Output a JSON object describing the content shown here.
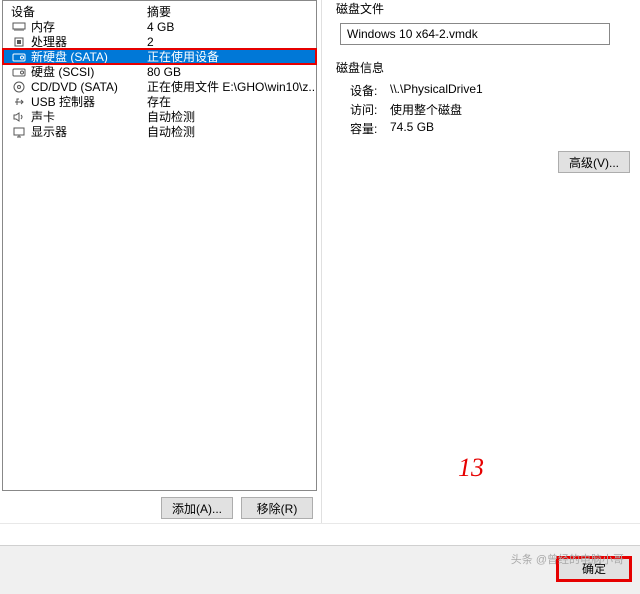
{
  "headers": {
    "device": "设备",
    "summary": "摘要"
  },
  "devices": [
    {
      "icon": "memory",
      "name": "内存",
      "summary": "4 GB",
      "selected": false
    },
    {
      "icon": "cpu",
      "name": "处理器",
      "summary": "2",
      "selected": false
    },
    {
      "icon": "disk",
      "name": "新硬盘 (SATA)",
      "summary": "正在使用设备",
      "selected": true
    },
    {
      "icon": "disk",
      "name": "硬盘 (SCSI)",
      "summary": "80 GB",
      "selected": false
    },
    {
      "icon": "cd",
      "name": "CD/DVD (SATA)",
      "summary": "正在使用文件 E:\\GHO\\win10\\z...",
      "selected": false
    },
    {
      "icon": "usb",
      "name": "USB 控制器",
      "summary": "存在",
      "selected": false
    },
    {
      "icon": "sound",
      "name": "声卡",
      "summary": "自动检测",
      "selected": false
    },
    {
      "icon": "display",
      "name": "显示器",
      "summary": "自动检测",
      "selected": false
    }
  ],
  "buttons": {
    "add": "添加(A)...",
    "remove": "移除(R)",
    "advanced": "高级(V)...",
    "ok": "确定"
  },
  "diskFile": {
    "title": "磁盘文件",
    "value": "Windows 10 x64-2.vmdk"
  },
  "diskInfo": {
    "title": "磁盘信息",
    "device_label": "设备:",
    "device_value": "\\\\.\\PhysicalDrive1",
    "access_label": "访问:",
    "access_value": "使用整个磁盘",
    "capacity_label": "容量:",
    "capacity_value": "74.5 GB"
  },
  "annotation": "13",
  "watermark": "头条 @曾经的电脑小哥"
}
